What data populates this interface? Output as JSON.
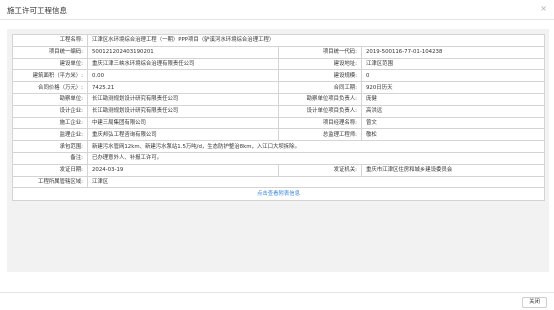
{
  "dialog": {
    "title": "施工许可工程信息",
    "close_icon": "×",
    "close_button": "关闭"
  },
  "fields": {
    "project_name": {
      "label": "工程名称:",
      "value": "江津区水环境综合治理工程（一期）PPP项目（驴溪河水环境综合治理工程）"
    },
    "project_code": {
      "label": "项目统一编码:",
      "value": "500121202403190201"
    },
    "credit_code": {
      "label": "项目统一代码:",
      "value": "2019-500116-77-01-104238"
    },
    "builder": {
      "label": "建设单位:",
      "value": "重庆江津三峡水环境综合治理有限责任公司"
    },
    "address": {
      "label": "建设地址:",
      "value": "江津区范围"
    },
    "area": {
      "label": "建筑面积（平方米）:",
      "value": "0.00"
    },
    "scale": {
      "label": "建设规模:",
      "value": "0"
    },
    "price": {
      "label": "合同价格（万元）:",
      "value": "7425.21"
    },
    "duration": {
      "label": "合同工期:",
      "value": "920日历天"
    },
    "survey_unit": {
      "label": "勘察单位:",
      "value": "长江勘测规划设计研究有限责任公司"
    },
    "survey_lead": {
      "label": "勘察单位项目负责人:",
      "value": "庞健"
    },
    "design_unit": {
      "label": "设计企业:",
      "value": "长江勘测规划设计研究有限责任公司"
    },
    "design_lead": {
      "label": "设计单位项目负责人:",
      "value": "高洪远"
    },
    "construction_unit": {
      "label": "施工企业:",
      "value": "中建三局集团有限公司"
    },
    "project_manager": {
      "label": "项目经理名称:",
      "value": "曾文"
    },
    "supervision_unit": {
      "label": "监理企业:",
      "value": "重庆邦弘工程咨询有限公司"
    },
    "chief_supervisor": {
      "label": "总监理工程师:",
      "value": "敬松"
    },
    "scope": {
      "label": "承包范围:",
      "value": "新建污水管网12km、新建污水泵站1.5万吨/d，生态防护整治8km，入江口大坝拆除。"
    },
    "remark": {
      "label": "备注:",
      "value": "已办理意外人、补报工许可。"
    },
    "issue_date": {
      "label": "发证日期:",
      "value": "2024-03-19"
    },
    "issuer": {
      "label": "发证机关:",
      "value": "重庆市江津区住房和城乡建设委员会"
    },
    "district": {
      "label": "工程所属管辖区域:",
      "value": "江津区"
    }
  },
  "more_link": "点击查看附表信息"
}
